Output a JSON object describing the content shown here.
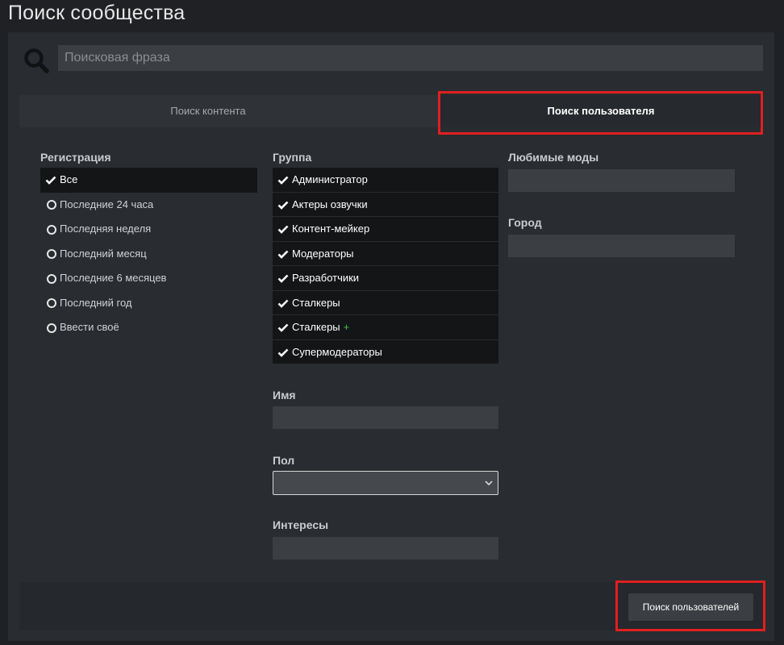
{
  "page": {
    "title": "Поиск сообщества"
  },
  "search": {
    "placeholder": "Поисковая фраза",
    "value": ""
  },
  "tabs": [
    {
      "label": "Поиск контента",
      "active": false
    },
    {
      "label": "Поиск пользователя",
      "active": true
    }
  ],
  "registration": {
    "label": "Регистрация",
    "options": [
      {
        "label": "Все",
        "selected": true
      },
      {
        "label": "Последние 24 часа",
        "selected": false
      },
      {
        "label": "Последняя неделя",
        "selected": false
      },
      {
        "label": "Последний месяц",
        "selected": false
      },
      {
        "label": "Последние 6 месяцев",
        "selected": false
      },
      {
        "label": "Последний год",
        "selected": false
      },
      {
        "label": "Ввести своё",
        "selected": false
      }
    ]
  },
  "group": {
    "label": "Группа",
    "options": [
      {
        "label": "Администратор",
        "checked": true
      },
      {
        "label": "Актеры озвучки",
        "checked": true
      },
      {
        "label": "Контент-мейкер",
        "checked": true
      },
      {
        "label": "Модераторы",
        "checked": true
      },
      {
        "label": "Разработчики",
        "checked": true
      },
      {
        "label": "Сталкеры",
        "checked": true
      },
      {
        "label": "Сталкеры",
        "checked": true,
        "badge": "+"
      },
      {
        "label": "Супермодераторы",
        "checked": true
      }
    ]
  },
  "name_field": {
    "label": "Имя",
    "value": ""
  },
  "gender_field": {
    "label": "Пол",
    "value": ""
  },
  "interests_field": {
    "label": "Интересы",
    "value": ""
  },
  "favorite_mods_field": {
    "label": "Любимые моды",
    "value": ""
  },
  "city_field": {
    "label": "Город",
    "value": ""
  },
  "submit": {
    "label": "Поиск пользователей"
  },
  "colors": {
    "background": "#1f2124",
    "panel": "#292c30",
    "input": "#3b3e43",
    "selected_row": "#141516",
    "highlight": "#e0201f",
    "plus_badge": "#3fbf4f"
  },
  "icons": {
    "search": "search-icon",
    "check": "check-icon",
    "radio": "radio-empty-icon",
    "dropdown": "chevron-down-icon"
  }
}
